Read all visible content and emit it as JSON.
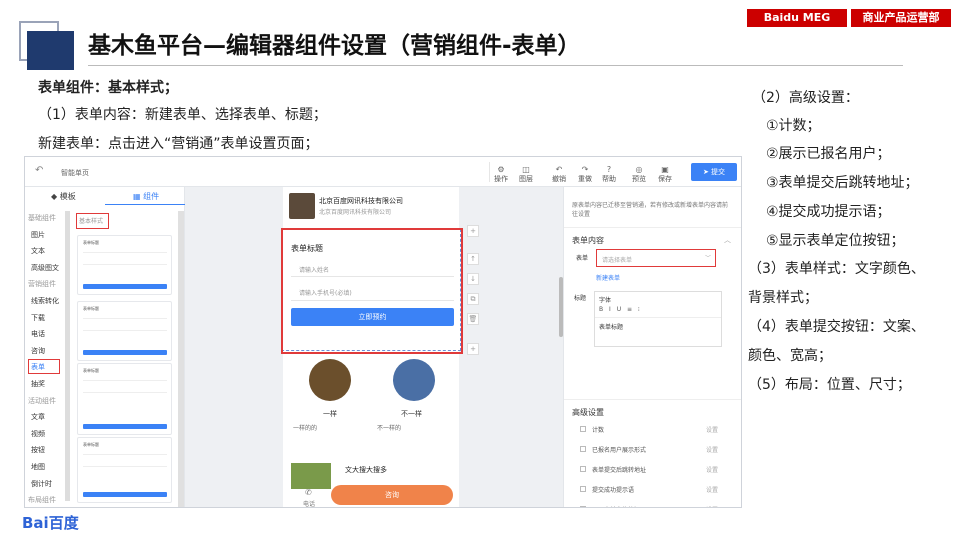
{
  "header": {
    "title": "基木鱼平台—编辑器组件设置（营销组件-表单）",
    "brand_left": "Baidu MEG",
    "brand_right": "商业产品运营部"
  },
  "left_text": {
    "heading": "表单组件：基本样式；",
    "line1": "（1）表单内容：新建表单、选择表单、标题；",
    "line2": "新建表单：点击进入“营销通”表单设置页面；"
  },
  "right_text": [
    "（2）高级设置：",
    "①计数；",
    "②展示已报名用户；",
    "③表单提交后跳转地址；",
    "④提交成功提示语；",
    "⑤显示表单定位按钮；",
    "（3）表单样式：文字颜色、",
    "背景样式；",
    "（4）表单提交按钮：文案、",
    "颜色、宽高；",
    "（5）布局：位置、尺寸；"
  ],
  "editor": {
    "back_icon": "back-arrow-icon",
    "page_name": "智能单页",
    "toolbar": [
      {
        "label": "操作",
        "icon": "layers-icon"
      },
      {
        "label": "图层",
        "icon": "stack-icon"
      },
      {
        "label": "撤销",
        "icon": "undo-icon"
      },
      {
        "label": "重做",
        "icon": "redo-icon"
      },
      {
        "label": "帮助",
        "icon": "help-icon"
      },
      {
        "label": "预览",
        "icon": "eye-icon"
      },
      {
        "label": "保存",
        "icon": "save-icon"
      }
    ],
    "publish": "提交",
    "tabs": {
      "template": "模板",
      "component": "组件"
    },
    "categories": [
      {
        "type": "header",
        "label": "基础组件"
      },
      {
        "type": "item",
        "label": "图片"
      },
      {
        "type": "item",
        "label": "文本"
      },
      {
        "type": "item",
        "label": "高级图文"
      },
      {
        "type": "header",
        "label": "营销组件"
      },
      {
        "type": "item",
        "label": "线索转化"
      },
      {
        "type": "item",
        "label": "下载"
      },
      {
        "type": "item",
        "label": "电话"
      },
      {
        "type": "item",
        "label": "咨询"
      },
      {
        "type": "item",
        "label": "表单",
        "selected": true
      },
      {
        "type": "item",
        "label": "抽奖"
      },
      {
        "type": "header",
        "label": "活动组件"
      },
      {
        "type": "item",
        "label": "文章"
      },
      {
        "type": "item",
        "label": "视频"
      },
      {
        "type": "item",
        "label": "按钮"
      },
      {
        "type": "item",
        "label": "地图"
      },
      {
        "type": "item",
        "label": "倒计时"
      },
      {
        "type": "header",
        "label": "布局组件"
      }
    ],
    "style_tag": "基本样式",
    "card_title": "表单标题",
    "canvas": {
      "company_name": "北京百度网讯科技有限公司",
      "company_sub": "北京百度网讯科技有限公司",
      "form_title": "表单标题",
      "name_placeholder": "请输入姓名",
      "phone_placeholder": "请输入手机号(必填)",
      "submit": "立即预约",
      "item1_title": "一样",
      "item1_sub": "一样的的",
      "item2_title": "不一样",
      "item2_sub": "不一样的",
      "article_title": "文大搜大搜多",
      "phone_label": "电话",
      "consult": "咨询"
    },
    "right_panel": {
      "note": "原表单内容已迁移至营销通，若有修改或新增表单内容请前往设置",
      "note_link": "营销通",
      "form_content": "表单内容",
      "form_label": "表单",
      "select_placeholder": "请选择表单",
      "new_form": "新建表单",
      "title_label": "标题",
      "font": "字体",
      "editor_value": "表单标题",
      "advanced": "高级设置",
      "adv_items": [
        "计数",
        "已报名用户展示形式",
        "表单提交后跳转地址",
        "提交成功提示语",
        "显示表单定位按钮"
      ],
      "setting": "设置"
    }
  },
  "footer": {
    "logo": "Bai百度"
  },
  "colors": {
    "brand_red": "#cc0000",
    "navy": "#1f3a6e",
    "accent": "#3b82f6",
    "consult": "#f0834a"
  }
}
